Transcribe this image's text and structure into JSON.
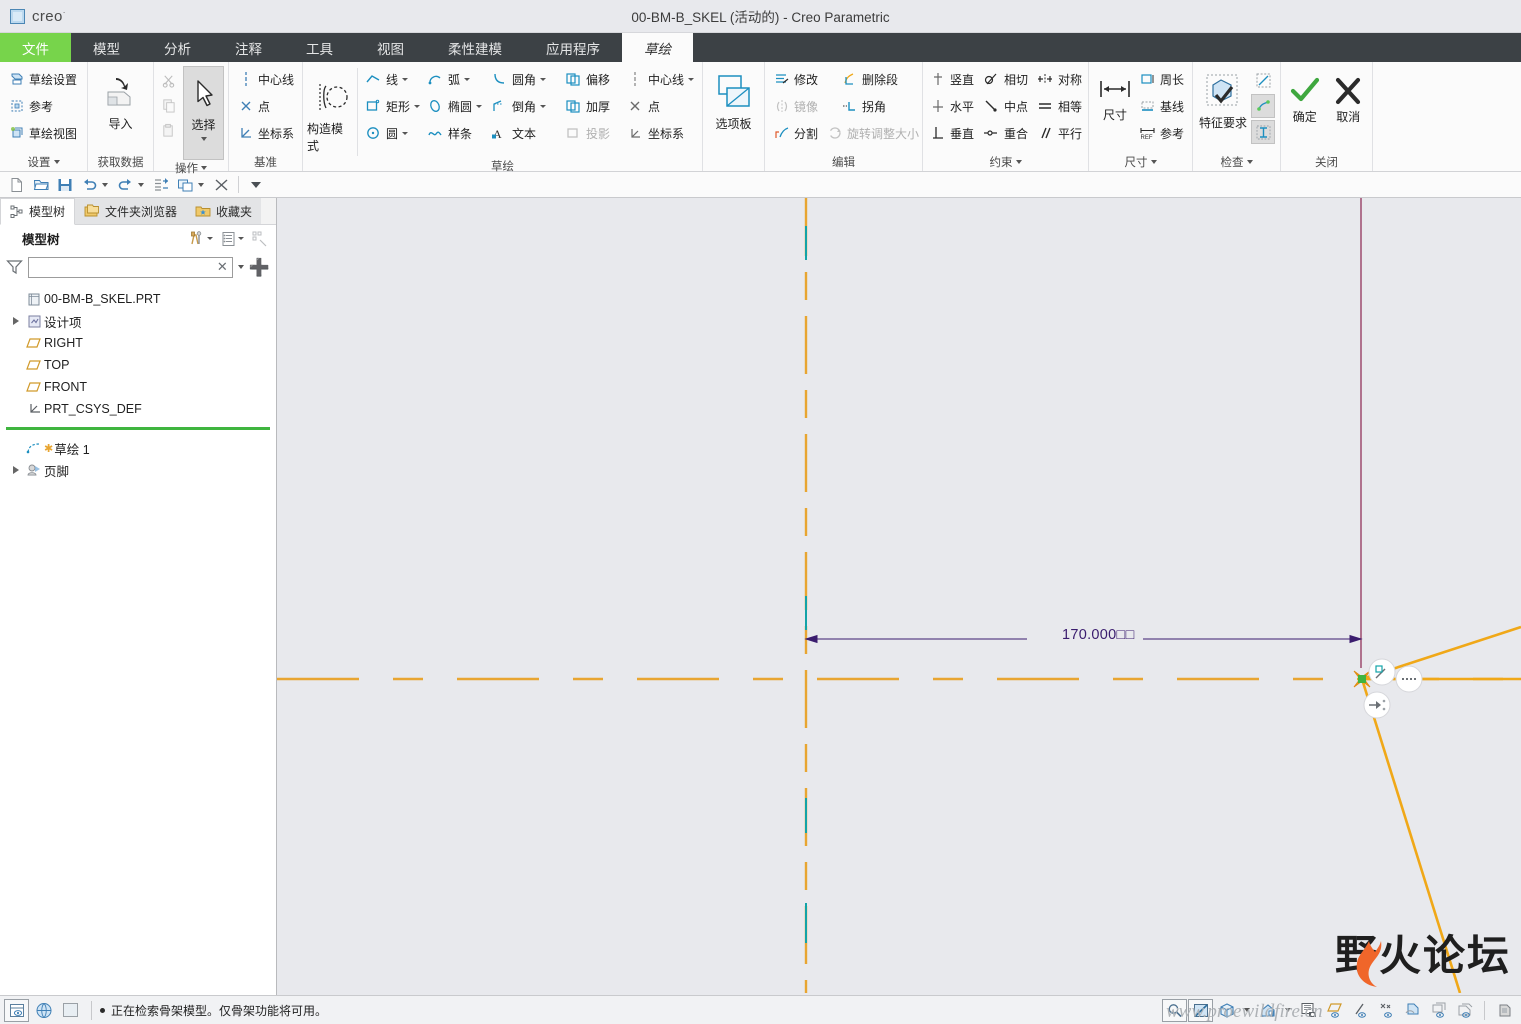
{
  "titlebar": {
    "brand": "creo",
    "brand_sup": "·",
    "title": "00-BM-B_SKEL (活动的) - Creo Parametric"
  },
  "ribbon_tabs": [
    {
      "label": "文件",
      "state": "file"
    },
    {
      "label": "模型",
      "state": "normal"
    },
    {
      "label": "分析",
      "state": "normal"
    },
    {
      "label": "注释",
      "state": "normal"
    },
    {
      "label": "工具",
      "state": "normal"
    },
    {
      "label": "视图",
      "state": "normal"
    },
    {
      "label": "柔性建模",
      "state": "normal"
    },
    {
      "label": "应用程序",
      "state": "normal"
    },
    {
      "label": "草绘",
      "state": "active"
    }
  ],
  "ribbon_groups": {
    "setup": {
      "title": "设置",
      "items": [
        {
          "label": "草绘设置",
          "icon": "sketch-setup-icon"
        },
        {
          "label": "参考",
          "icon": "reference-icon"
        },
        {
          "label": "草绘视图",
          "icon": "sketch-view-icon"
        }
      ]
    },
    "get_data": {
      "title": "获取数据",
      "big": {
        "label": "导入",
        "icon": "import-icon"
      }
    },
    "operations": {
      "title": "操作",
      "small": [
        {
          "label": "",
          "icon": "cut-icon",
          "disabled": true
        },
        {
          "label": "",
          "icon": "copy-icon",
          "disabled": true
        },
        {
          "label": "",
          "icon": "paste-icon",
          "disabled": true
        }
      ],
      "big": {
        "label": "选择",
        "icon": "select-arrow-icon",
        "selected": true
      }
    },
    "datum": {
      "title": "基准",
      "items": [
        {
          "label": "中心线",
          "icon": "centerline-icon"
        },
        {
          "label": "点",
          "icon": "point-icon"
        },
        {
          "label": "坐标系",
          "icon": "coord-system-icon"
        }
      ]
    },
    "construction": {
      "big": {
        "label": "构造模式",
        "icon": "construction-mode-icon"
      }
    },
    "sketching": {
      "title": "草绘",
      "row1": [
        {
          "label": "线",
          "icon": "line-icon",
          "dropdown": true
        },
        {
          "label": "弧",
          "icon": "arc-icon",
          "dropdown": true
        },
        {
          "label": "圆角",
          "icon": "fillet-icon",
          "dropdown": true
        },
        {
          "label": "偏移",
          "icon": "offset-icon",
          "dropdown": false
        },
        {
          "label": "中心线",
          "icon": "centerline-icon",
          "dropdown": true
        }
      ],
      "row2": [
        {
          "label": "矩形",
          "icon": "rectangle-icon",
          "dropdown": true
        },
        {
          "label": "椭圆",
          "icon": "ellipse-icon",
          "dropdown": true
        },
        {
          "label": "倒角",
          "icon": "chamfer-icon",
          "dropdown": true
        },
        {
          "label": "加厚",
          "icon": "thicken-icon",
          "dropdown": false
        },
        {
          "label": "点",
          "icon": "point-icon",
          "dropdown": false
        }
      ],
      "row3": [
        {
          "label": "圆",
          "icon": "circle-icon",
          "dropdown": true
        },
        {
          "label": "样条",
          "icon": "spline-icon",
          "dropdown": false
        },
        {
          "label": "文本",
          "icon": "text-icon",
          "dropdown": false
        },
        {
          "label": "投影",
          "icon": "project-icon",
          "dropdown": false,
          "disabled": true
        },
        {
          "label": "坐标系",
          "icon": "coord-system-icon",
          "dropdown": false
        }
      ]
    },
    "palette": {
      "big": {
        "label": "选项板",
        "icon": "palette-icon"
      }
    },
    "edit": {
      "title": "编辑",
      "row1": [
        {
          "label": "修改",
          "icon": "modify-icon"
        },
        {
          "label": "删除段",
          "icon": "delete-segment-icon"
        }
      ],
      "row2": [
        {
          "label": "镜像",
          "icon": "mirror-icon",
          "disabled": true
        },
        {
          "label": "拐角",
          "icon": "corner-icon"
        }
      ],
      "row3": [
        {
          "label": "分割",
          "icon": "divide-icon"
        },
        {
          "label": "旋转调整大小",
          "icon": "rotate-resize-icon",
          "disabled": true
        }
      ]
    },
    "constraints": {
      "title": "约束",
      "row1": [
        {
          "label": "竖直",
          "icon": "vertical-constraint-icon"
        },
        {
          "label": "相切",
          "icon": "tangent-constraint-icon"
        },
        {
          "label": "对称",
          "icon": "symmetric-constraint-icon"
        }
      ],
      "row2": [
        {
          "label": "水平",
          "icon": "horizontal-constraint-icon"
        },
        {
          "label": "中点",
          "icon": "midpoint-constraint-icon"
        },
        {
          "label": "相等",
          "icon": "equal-constraint-icon"
        }
      ],
      "row3": [
        {
          "label": "垂直",
          "icon": "perpendicular-constraint-icon"
        },
        {
          "label": "重合",
          "icon": "coincident-constraint-icon"
        },
        {
          "label": "平行",
          "icon": "parallel-constraint-icon"
        }
      ]
    },
    "dimension": {
      "title": "尺寸",
      "big": {
        "label": "尺寸",
        "icon": "dimension-icon"
      },
      "items": [
        {
          "label": "周长",
          "icon": "perimeter-icon"
        },
        {
          "label": "基线",
          "icon": "baseline-icon"
        },
        {
          "label": "参考",
          "icon": "ref-dimension-icon"
        }
      ]
    },
    "inspect": {
      "title": "检查",
      "big": {
        "label": "特征要求",
        "icon": "feature-requirements-icon"
      },
      "toggles": [
        {
          "icon": "overlapping-geometry-icon",
          "active": false
        },
        {
          "icon": "highlight-open-ends-icon",
          "active": true
        },
        {
          "icon": "shade-closed-loops-icon",
          "active": true
        }
      ]
    },
    "close": {
      "title": "关闭",
      "items": [
        {
          "label": "确定",
          "icon": "ok-check-icon"
        },
        {
          "label": "取消",
          "icon": "cancel-x-icon"
        }
      ]
    }
  },
  "quick_access": [
    {
      "icon": "new-file-icon",
      "name": "new"
    },
    {
      "icon": "open-folder-icon",
      "name": "open"
    },
    {
      "icon": "save-icon",
      "name": "save"
    },
    {
      "icon": "undo-icon",
      "name": "undo",
      "dropdown": true
    },
    {
      "icon": "redo-icon",
      "name": "redo",
      "dropdown": true
    },
    {
      "icon": "regenerate-icon",
      "name": "regenerate"
    },
    {
      "icon": "window-icon",
      "name": "window",
      "dropdown": true
    },
    {
      "icon": "close-window-icon",
      "name": "close"
    },
    {
      "icon": "customize-icon",
      "name": "customize"
    }
  ],
  "sidebar": {
    "nav_tabs": [
      {
        "label": "模型树",
        "icon": "model-tree-icon",
        "active": true
      },
      {
        "label": "文件夹浏览器",
        "icon": "folder-browser-icon",
        "active": false
      },
      {
        "label": "收藏夹",
        "icon": "favorites-icon",
        "active": false
      }
    ],
    "panel_title": "模型树",
    "filter_value": "",
    "filter_placeholder": "",
    "tree": [
      {
        "label": "00-BM-B_SKEL.PRT",
        "icon": "part-icon",
        "indent": 0,
        "expander": false
      },
      {
        "label": "设计项",
        "icon": "design-items-icon",
        "indent": 1,
        "expander": true
      },
      {
        "label": "RIGHT",
        "icon": "datum-plane-icon",
        "indent": 1,
        "expander": false
      },
      {
        "label": "TOP",
        "icon": "datum-plane-icon",
        "indent": 1,
        "expander": false
      },
      {
        "label": "FRONT",
        "icon": "datum-plane-icon",
        "indent": 1,
        "expander": false
      },
      {
        "label": "PRT_CSYS_DEF",
        "icon": "csys-icon",
        "indent": 1,
        "expander": false
      }
    ],
    "tree_after": [
      {
        "label": "草绘 1",
        "icon": "sketch-feature-icon",
        "indent": 1,
        "expander": false,
        "asterisk": true
      },
      {
        "label": "页脚",
        "icon": "footer-icon",
        "indent": 1,
        "expander": true
      }
    ]
  },
  "canvas": {
    "background": "#e8e9ed",
    "dimension_label": "170.000□□",
    "colors": {
      "centerline": "#e8a531",
      "construction": "#12a3a8",
      "dimension": "#3a1c6e",
      "datum_plane_line": "#8a2450",
      "geometry": "#f0a818",
      "snap_point": "#3fb53f"
    },
    "cursor_badges": [
      "constraint-tangent-badge",
      "constraint-dots-badge",
      "constraint-coincident-badge"
    ]
  },
  "watermark": {
    "brand_cn": "野火论坛",
    "site": "www.proewildfire.cn"
  },
  "status_bar": {
    "left_icons": [
      "layer-display-icon",
      "globe-icon",
      "blank-icon"
    ],
    "message": "正在检索骨架模型。仅骨架功能将可用。",
    "right_icons": [
      "zoom-icon",
      "refit-icon",
      "shading-icon",
      "shading-dropdown",
      "appearance-icon",
      "appearance-dropdown",
      "saved-views-icon",
      "datum-plane-display-icon",
      "datum-axis-display-icon",
      "datum-point-display-icon",
      "csys-display-icon",
      "annotation-display-icon",
      "spin-center-icon"
    ]
  }
}
